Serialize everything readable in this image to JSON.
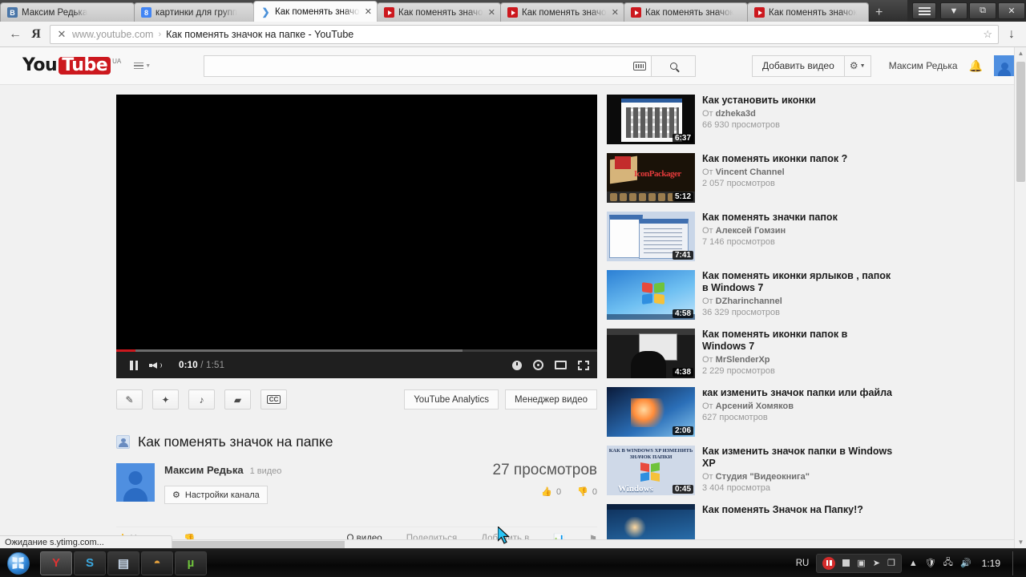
{
  "browser": {
    "tabs": [
      {
        "title": "Максим Редька",
        "favicon": "vk-icon",
        "active": false,
        "closable": false
      },
      {
        "title": "картинки для групп",
        "favicon": "google-icon",
        "active": false,
        "closable": false
      },
      {
        "title": "Как поменять значок",
        "favicon": "loading-icon",
        "active": true,
        "closable": true
      },
      {
        "title": "Как поменять значок",
        "favicon": "youtube-icon",
        "active": false,
        "closable": true
      },
      {
        "title": "Как поменять значок",
        "favicon": "youtube-icon",
        "active": false,
        "closable": true
      },
      {
        "title": "Как поменять значок",
        "favicon": "youtube-icon",
        "active": false,
        "closable": false
      },
      {
        "title": "Как поменять значок",
        "favicon": "youtube-icon",
        "active": false,
        "closable": false
      }
    ],
    "new_tab_label": "+",
    "window_controls": {
      "minimize": "▼",
      "restore": "⧉",
      "close": "✕"
    },
    "back_label": "←",
    "yandex_label": "Я",
    "stop_label": "✕",
    "url_host": "www.youtube.com",
    "url_separator": "›",
    "url_title": "Как поменять значок на папке - YouTube",
    "bookmark_label": "☆",
    "download_label": "↓"
  },
  "yt_header": {
    "logo_you": "You",
    "logo_tube": "Tube",
    "logo_country": "UA",
    "search_value": "",
    "search_placeholder": "",
    "upload_label": "Добавить видео",
    "gear_label": "⚙",
    "user_name": "Максим Редька",
    "bell_label": "🔔"
  },
  "player": {
    "pause_label": "Пауза",
    "current_time": "0:10",
    "separator": " / ",
    "total_time": "1:51",
    "progress_played_pct": 4,
    "progress_loaded_pct": 72
  },
  "actions": {
    "icons": [
      "edit-icon",
      "enhance-icon",
      "audio-icon",
      "annotation-icon",
      "cc-icon"
    ],
    "cc_label": "CC",
    "analytics_label": "YouTube Analytics",
    "manager_label": "Менеджер видео"
  },
  "video": {
    "title": "Как поменять значок на папке",
    "channel": "Максим Редька",
    "video_count": "1 видео",
    "settings_label": "Настройки канала",
    "views": "27 просмотров",
    "likes": "0",
    "dislikes": "0"
  },
  "bottom_tabs": {
    "like_label": "Нравится",
    "tabs": [
      {
        "label": "О видео",
        "active": true
      },
      {
        "label": "Поделиться",
        "active": false
      },
      {
        "label": "Добавить в",
        "active": false
      }
    ],
    "stats_icon": "stats-icon",
    "flag_icon": "flag-icon"
  },
  "sidebar": {
    "by_prefix": "От",
    "items": [
      {
        "title": "Как установить иконки",
        "author": "dzheka3d",
        "views": "66 930 просмотров",
        "duration": "6:37",
        "thumb": "t1"
      },
      {
        "title": "Как поменять иконки папок ?",
        "author": "Vincent Channel",
        "views": "2 057 просмотров",
        "duration": "5:12",
        "thumb": "t2"
      },
      {
        "title": "Как поменять значки папок",
        "author": "Алексей Гомзин",
        "views": "7 146 просмотров",
        "duration": "7:41",
        "thumb": "t3"
      },
      {
        "title": "Как поменять иконки ярлыков , папок в Windows 7",
        "author": "DZharinchannel",
        "views": "36 329 просмотров",
        "duration": "4:58",
        "thumb": "t4"
      },
      {
        "title": "Как поменять иконки папок в Windows 7",
        "author": "MrSlenderXp",
        "views": "2 229 просмотров",
        "duration": "4:38",
        "thumb": "t5"
      },
      {
        "title": "как изменить значок папки или файла",
        "author": "Арсений Хомяков",
        "views": "627 просмотров",
        "duration": "2:06",
        "thumb": "t6"
      },
      {
        "title": "Как изменить значок папки в Windows XP",
        "author": "Студия \"Видеокнига\"",
        "views": "3 404 просмотра",
        "duration": "0:45",
        "thumb": "t7"
      },
      {
        "title": "Как поменять Значок на Папку!?",
        "author": "",
        "views": "",
        "duration": "",
        "thumb": "t8"
      }
    ],
    "thumb_xp_caption": "КАК В WINDOWS XP ИЗМЕНИТЬ ЗНАЧОК ПАПКИ",
    "thumb_xp_brand": "Windows",
    "thumb_xp_brand_sup": "XP"
  },
  "status_bar": {
    "text": "Ожидание s.ytimg.com..."
  },
  "taskbar": {
    "start_label": "Пуск",
    "items": [
      {
        "name": "yandex-browser",
        "glyph": "Y",
        "color": "#e03232",
        "active": true
      },
      {
        "name": "skype",
        "glyph": "S",
        "color": "#3ba9e0",
        "active": false
      },
      {
        "name": "notepad",
        "glyph": "▤",
        "color": "#c8d8ea",
        "active": false
      },
      {
        "name": "amigo-browser",
        "glyph": "◓",
        "color": "#e8a33d",
        "active": false
      },
      {
        "name": "utorrent",
        "glyph": "µ",
        "color": "#6fc33c",
        "active": false
      }
    ],
    "language": "RU",
    "clock": "1:19",
    "tray_icons": [
      "recorder-pause-icon",
      "recorder-stop-icon",
      "recorder-capture-icon",
      "recorder-cursor-icon",
      "recorder-window-icon",
      "show-hidden-icon",
      "antivirus-icon",
      "network-icon",
      "volume-icon"
    ]
  },
  "colors": {
    "youtube_red": "#cc181e",
    "accent_blue": "#4f8fe0",
    "page_bg": "#f1f1f1"
  }
}
